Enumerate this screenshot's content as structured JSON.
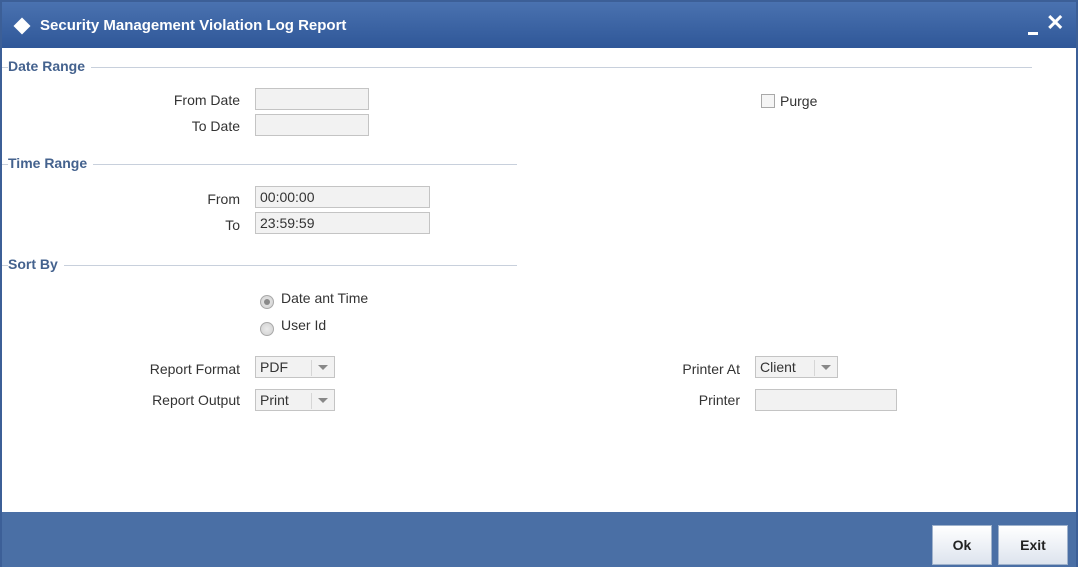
{
  "window": {
    "title": "Security Management Violation Log Report",
    "icons": {
      "app": "diamond-icon",
      "minimize": "minimize-icon",
      "close": "close-icon"
    },
    "minimize_glyph": "_",
    "close_glyph": "✕"
  },
  "date_range": {
    "legend": "Date Range",
    "from_label": "From Date",
    "from_value": "",
    "to_label": "To Date",
    "to_value": "",
    "purge_label": "Purge",
    "purge_checked": false
  },
  "time_range": {
    "legend": "Time Range",
    "from_label": "From",
    "from_value": "00:00:00",
    "to_label": "To",
    "to_value": "23:59:59"
  },
  "sort_by": {
    "legend": "Sort By",
    "options": [
      {
        "label": "Date ant Time",
        "selected": true
      },
      {
        "label": "User Id",
        "selected": false
      }
    ]
  },
  "report": {
    "format_label": "Report Format",
    "format_value": "PDF",
    "output_label": "Report Output",
    "output_value": "Print",
    "printer_at_label": "Printer At",
    "printer_at_value": "Client",
    "printer_label": "Printer",
    "printer_value": ""
  },
  "footer": {
    "ok_label": "Ok",
    "exit_label": "Exit"
  },
  "colors": {
    "titlebar": "#3a62a3",
    "footer": "#4a6fa5",
    "legend_text": "#44628e"
  }
}
